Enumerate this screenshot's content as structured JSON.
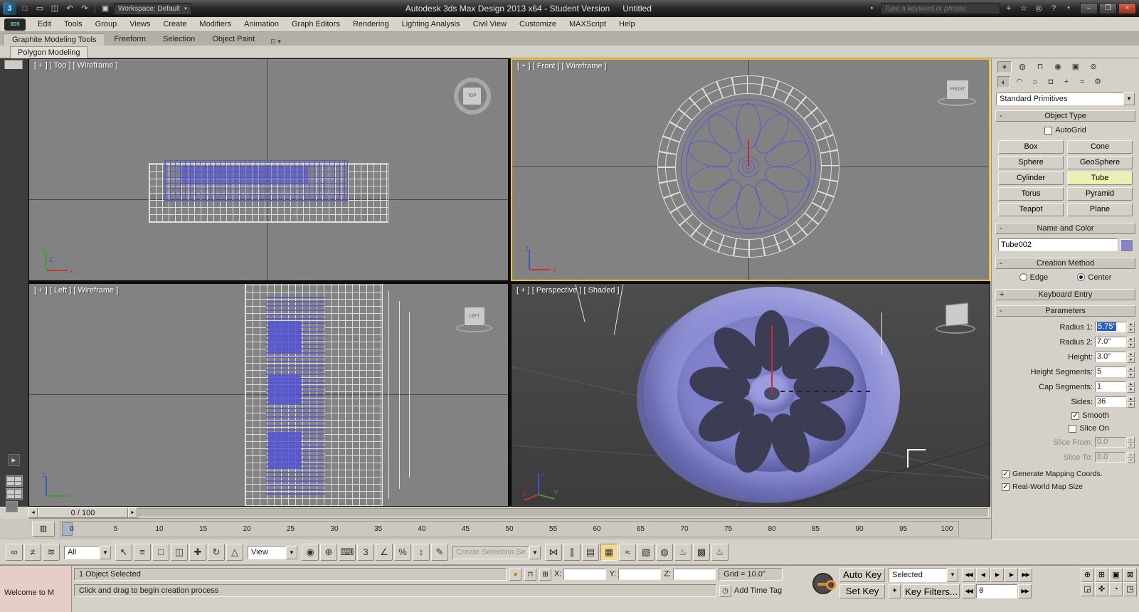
{
  "titlebar": {
    "workspace": "Workspace: Default",
    "title": "Autodesk 3ds Max Design 2013 x64 - Student Version",
    "document": "Untitled",
    "search_placeholder": "Type a keyword or phrase"
  },
  "menubar": {
    "items": [
      "Edit",
      "Tools",
      "Group",
      "Views",
      "Create",
      "Modifiers",
      "Animation",
      "Graph Editors",
      "Rendering",
      "Lighting Analysis",
      "Civil View",
      "Customize",
      "MAXScript",
      "Help"
    ]
  },
  "ribbon": {
    "tabs": [
      {
        "label": "Graphite Modeling Tools",
        "name": "tab-graphite-modeling-tools",
        "active": true
      },
      {
        "label": "Freeform",
        "name": "tab-freeform"
      },
      {
        "label": "Selection",
        "name": "tab-selection"
      },
      {
        "label": "Object Paint",
        "name": "tab-object-paint"
      }
    ],
    "subtab": "Polygon Modeling"
  },
  "viewports": {
    "top": {
      "label": "[ + ] [ Top ] [ Wireframe ]",
      "cube": "TOP"
    },
    "front": {
      "label": "[ + ] [ Front ] [ Wireframe ]",
      "cube": "FRONT"
    },
    "left": {
      "label": "[ + ] [ Left ] [ Wireframe ]",
      "cube": "LEFT"
    },
    "perspective": {
      "label": "[ + ] [ Perspective ] [ Shaded ]"
    }
  },
  "command_panel": {
    "tabs_row1": [
      {
        "name": "create-tab-icon",
        "glyph": "✶",
        "active": true
      },
      {
        "name": "modify-tab-icon",
        "glyph": "◍"
      },
      {
        "name": "hierarchy-tab-icon",
        "glyph": "⊓"
      },
      {
        "name": "motion-tab-icon",
        "glyph": "◉"
      },
      {
        "name": "display-tab-icon",
        "glyph": "▣"
      },
      {
        "name": "utilities-tab-icon",
        "glyph": "⊚"
      }
    ],
    "tabs_row2": [
      {
        "name": "geometry-category-icon",
        "glyph": "◐",
        "active": true
      },
      {
        "name": "shapes-category-icon",
        "glyph": "◠"
      },
      {
        "name": "lights-category-icon",
        "glyph": "☼"
      },
      {
        "name": "cameras-category-icon",
        "glyph": "◘"
      },
      {
        "name": "helpers-category-icon",
        "glyph": "+"
      },
      {
        "name": "space-warps-category-icon",
        "glyph": "≈"
      },
      {
        "name": "systems-category-icon",
        "glyph": "⚙"
      }
    ],
    "category": "Standard Primitives",
    "object_type": {
      "title": "Object Type",
      "autogrid": "AutoGrid",
      "buttons": [
        {
          "label": "Box",
          "name": "box-button"
        },
        {
          "label": "Cone",
          "name": "cone-button"
        },
        {
          "label": "Sphere",
          "name": "sphere-button"
        },
        {
          "label": "GeoSphere",
          "name": "geosphere-button"
        },
        {
          "label": "Cylinder",
          "name": "cylinder-button"
        },
        {
          "label": "Tube",
          "name": "tube-button",
          "active": true
        },
        {
          "label": "Torus",
          "name": "torus-button"
        },
        {
          "label": "Pyramid",
          "name": "pyramid-button"
        },
        {
          "label": "Teapot",
          "name": "teapot-button"
        },
        {
          "label": "Plane",
          "name": "plane-button"
        }
      ]
    },
    "name_and_color": {
      "title": "Name and Color",
      "object_name": "Tube002"
    },
    "creation_method": {
      "title": "Creation Method",
      "edge": "Edge",
      "center": "Center"
    },
    "keyboard_entry": {
      "title": "Keyboard Entry"
    },
    "parameters": {
      "title": "Parameters",
      "radius1_label": "Radius 1:",
      "radius1_value": "5.75\"",
      "radius2_label": "Radius 2:",
      "radius2_value": "7.0\"",
      "height_label": "Height:",
      "height_value": "3.0\"",
      "height_segs_label": "Height Segments:",
      "height_segs_value": "5",
      "cap_segs_label": "Cap Segments:",
      "cap_segs_value": "1",
      "sides_label": "Sides:",
      "sides_value": "36",
      "smooth": "Smooth",
      "slice_on": "Slice On",
      "slice_from_label": "Slice From:",
      "slice_from_value": "0.0",
      "slice_to_label": "Slice To:",
      "slice_to_value": "0.0",
      "gen_mapping": "Generate Mapping Coords.",
      "real_world": "Real-World Map Size"
    }
  },
  "timeline": {
    "slider": "0 / 100",
    "ticks": [
      "0",
      "5",
      "10",
      "15",
      "20",
      "25",
      "30",
      "35",
      "40",
      "45",
      "50",
      "55",
      "60",
      "65",
      "70",
      "75",
      "80",
      "85",
      "90",
      "95",
      "100"
    ]
  },
  "toolbar": {
    "selection_filter": "All",
    "coordinate_system": "View",
    "named_sets": "Create Selection Se",
    "group_a": [
      {
        "name": "select-and-link-icon",
        "glyph": "∞"
      },
      {
        "name": "unlink-selection-icon",
        "glyph": "≠"
      },
      {
        "name": "bind-to-space-warp-icon",
        "glyph": "≋"
      }
    ],
    "group_b": [
      {
        "name": "select-object-icon",
        "glyph": "↖"
      },
      {
        "name": "select-by-name-icon",
        "glyph": "≡"
      },
      {
        "name": "rectangular-selection-region-icon",
        "glyph": "□"
      },
      {
        "name": "window-crossing-icon",
        "glyph": "◫"
      },
      {
        "name": "select-and-move-icon",
        "glyph": "✚"
      },
      {
        "name": "select-and-rotate-icon",
        "glyph": "↻"
      },
      {
        "name": "select-and-scale-icon",
        "glyph": "△"
      }
    ],
    "group_c": [
      {
        "name": "use-pivot-point-center-icon",
        "glyph": "◉"
      },
      {
        "name": "select-and-manipulate-icon",
        "glyph": "⊕"
      },
      {
        "name": "keyboard-shortcut-override-icon",
        "glyph": "⌨"
      },
      {
        "name": "snaps-toggle-icon",
        "glyph": "3"
      },
      {
        "name": "angle-snap-icon",
        "glyph": "∠"
      },
      {
        "name": "percent-snap-icon",
        "glyph": "%"
      },
      {
        "name": "spinner-snap-icon",
        "glyph": "↕"
      },
      {
        "name": "edit-named-selection-sets-icon",
        "glyph": "✎"
      }
    ],
    "group_d": [
      {
        "name": "mirror-icon",
        "glyph": "⋈"
      },
      {
        "name": "align-icon",
        "glyph": "∥"
      },
      {
        "name": "layer-manager-icon",
        "glyph": "▤"
      },
      {
        "name": "graphite-ribbon-toggle-icon",
        "glyph": "▦",
        "active": true
      },
      {
        "name": "curve-editor-icon",
        "glyph": "≈"
      },
      {
        "name": "schematic-view-icon",
        "glyph": "▧"
      },
      {
        "name": "material-editor-icon",
        "glyph": "◍"
      },
      {
        "name": "render-setup-icon",
        "glyph": "♨"
      },
      {
        "name": "rendered-frame-window-icon",
        "glyph": "▩"
      },
      {
        "name": "render-production-icon",
        "glyph": "♨"
      }
    ]
  },
  "statusbar": {
    "selection_status": "1 Object Selected",
    "prompt": "Click and drag to begin creation process",
    "welcome_title": "Welcome to M",
    "x_label": "X:",
    "y_label": "Y:",
    "z_label": "Z:",
    "x_value": "",
    "y_value": "",
    "z_value": "",
    "grid": "Grid = 10.0\"",
    "add_time_tag": "Add Time Tag",
    "auto_key": "Auto Key",
    "set_key": "Set Key",
    "selected_filter": "Selected",
    "key_filters": "Key Filters...",
    "frame": "0",
    "playback": [
      {
        "name": "go-to-start-button",
        "glyph": "◀◀"
      },
      {
        "name": "previous-frame-button",
        "glyph": "◀"
      },
      {
        "name": "play-animation-button",
        "glyph": "▶"
      },
      {
        "name": "next-frame-button",
        "glyph": "▶"
      },
      {
        "name": "go-to-end-button",
        "glyph": "▶▶"
      }
    ],
    "nav": [
      {
        "name": "zoom-icon",
        "glyph": "⊕"
      },
      {
        "name": "zoom-all-icon",
        "glyph": "⊞"
      },
      {
        "name": "zoom-extents-icon",
        "glyph": "▣"
      },
      {
        "name": "zoom-extents-all-icon",
        "glyph": "⊠"
      },
      {
        "name": "zoom-region-icon",
        "glyph": "◲"
      },
      {
        "name": "pan-view-icon",
        "glyph": "✜"
      },
      {
        "name": "orbit-icon",
        "glyph": "◔"
      },
      {
        "name": "maximize-viewport-toggle-icon",
        "glyph": "◳"
      }
    ]
  },
  "colors": {
    "viewport_selected_border": "#edc42c",
    "object_shaded_fill": "#8e8ed6",
    "selected_wireframe": "#5b5bd0",
    "active_primitive_button": "#e9f0b2",
    "text_selection": "#2a5cc8"
  }
}
